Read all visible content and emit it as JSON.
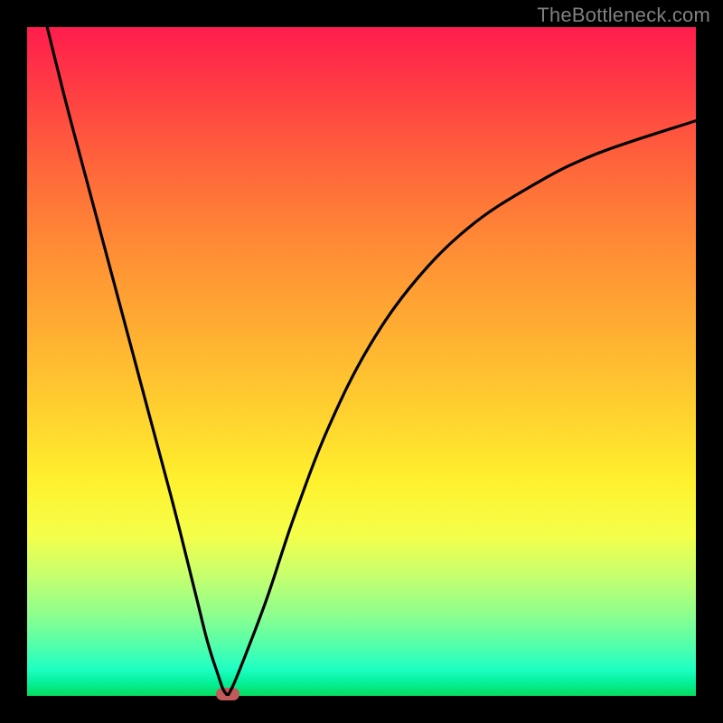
{
  "watermark": "TheBottleneck.com",
  "colors": {
    "frame": "#000000",
    "watermark": "#808080",
    "curve": "#000000",
    "dip_marker": "#c25a5a"
  },
  "chart_data": {
    "type": "line",
    "title": "",
    "xlabel": "",
    "ylabel": "",
    "xlim": [
      0,
      100
    ],
    "ylim": [
      0,
      100
    ],
    "grid": false,
    "legend": false,
    "series": [
      {
        "name": "left-branch",
        "x": [
          3,
          6,
          10,
          14,
          18,
          22,
          25,
          27,
          28.6,
          29.3,
          30
        ],
        "y": [
          100,
          88,
          73,
          58,
          43,
          28,
          16,
          8,
          3,
          1,
          0
        ]
      },
      {
        "name": "right-branch",
        "x": [
          30,
          31,
          33,
          36,
          40,
          45,
          51,
          58,
          66,
          75,
          85,
          100
        ],
        "y": [
          0,
          2,
          7,
          15,
          27,
          40,
          52,
          62,
          70,
          76,
          81,
          86
        ]
      }
    ],
    "annotations": [
      {
        "name": "dip-marker",
        "x": 30,
        "y": 0
      }
    ]
  }
}
